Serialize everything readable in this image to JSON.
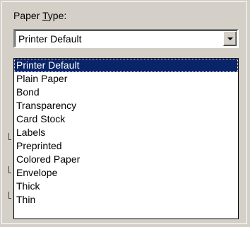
{
  "paper_type": {
    "label_prefix": "Paper ",
    "label_mnemonic": "T",
    "label_suffix": "ype:",
    "selected_value": "Printer Default",
    "options": [
      "Printer Default",
      "Plain Paper",
      "Bond",
      "Transparency",
      "Card Stock",
      "Labels",
      "Preprinted",
      "Colored Paper",
      "Envelope",
      "Thick",
      "Thin"
    ],
    "highlighted_index": 0
  },
  "icons": {
    "dropdown_arrow": "chevron-down-icon"
  },
  "colors": {
    "highlight": "#0a246a",
    "face": "#d4d0c8"
  }
}
